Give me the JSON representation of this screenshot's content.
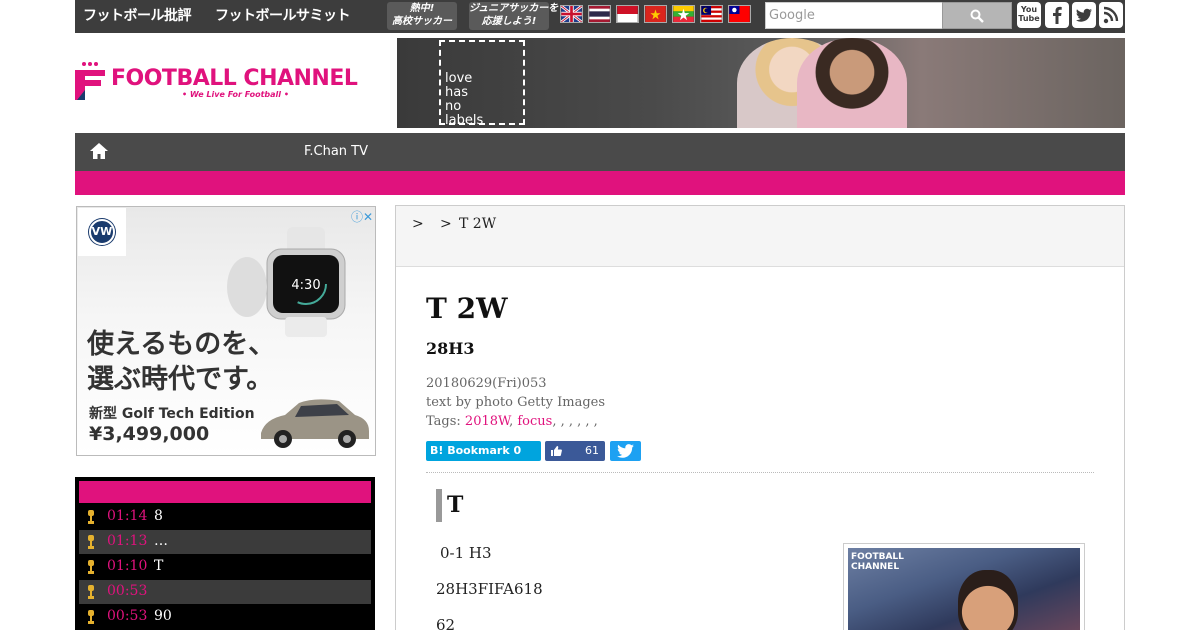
{
  "topbar": {
    "links": [
      "フットボール批評",
      "フットボールサミット"
    ],
    "badges": [
      "熱中!\n高校サッカー",
      "ジュニアサッカーを\n応援しよう!"
    ],
    "flags": [
      "uk-flag",
      "thailand-flag",
      "indonesia-flag",
      "vietnam-flag",
      "myanmar-flag",
      "malaysia-flag",
      "taiwan-flag"
    ],
    "search_placeholder": "Google",
    "social": [
      "YouTube",
      "facebook",
      "twitter",
      "rss"
    ],
    "youtube_label": "You\nTube"
  },
  "header": {
    "logo_name": "FOOTBALL CHANNEL",
    "logo_tagline": "• We Live For Football •",
    "banner_text": "love\nhas\nno\nlabels"
  },
  "nav": {
    "items": [
      "F.Chan TV"
    ]
  },
  "side_ad": {
    "brand": "VW",
    "headline": "使えるものを、\n選ぶ時代です。",
    "sub": "新型 Golf Tech Edition",
    "price": "¥3,499,000",
    "watch_time": "4:30"
  },
  "ranking": {
    "rows": [
      {
        "time": "01:14",
        "title": "8"
      },
      {
        "time": "01:13",
        "title": "…"
      },
      {
        "time": "01:10",
        "title": "T"
      },
      {
        "time": "00:53",
        "title": ""
      },
      {
        "time": "00:53",
        "title": "90"
      }
    ]
  },
  "article": {
    "breadcrumb": [
      ">",
      ">",
      "T 2W"
    ],
    "title": "T 2W",
    "subtitle": "28H3",
    "date": "20180629(Fri)053",
    "byline": "text by  photo Getty Images",
    "tags_label": "Tags: ",
    "tags": [
      "2018W",
      "focus"
    ],
    "tags_rest": ", , , , , ,",
    "hatena_label": "B! Bookmark 0",
    "like_count": "61",
    "section_heading": "T",
    "paragraphs": [
      "0-1  H3",
      "28H3FIFA618",
      "62"
    ],
    "photo_logo": "FOOTBALL\nCHANNEL"
  },
  "colors": {
    "accent": "#e0127d",
    "topbar": "#3d3d3d",
    "nav": "#4a4a4a"
  }
}
